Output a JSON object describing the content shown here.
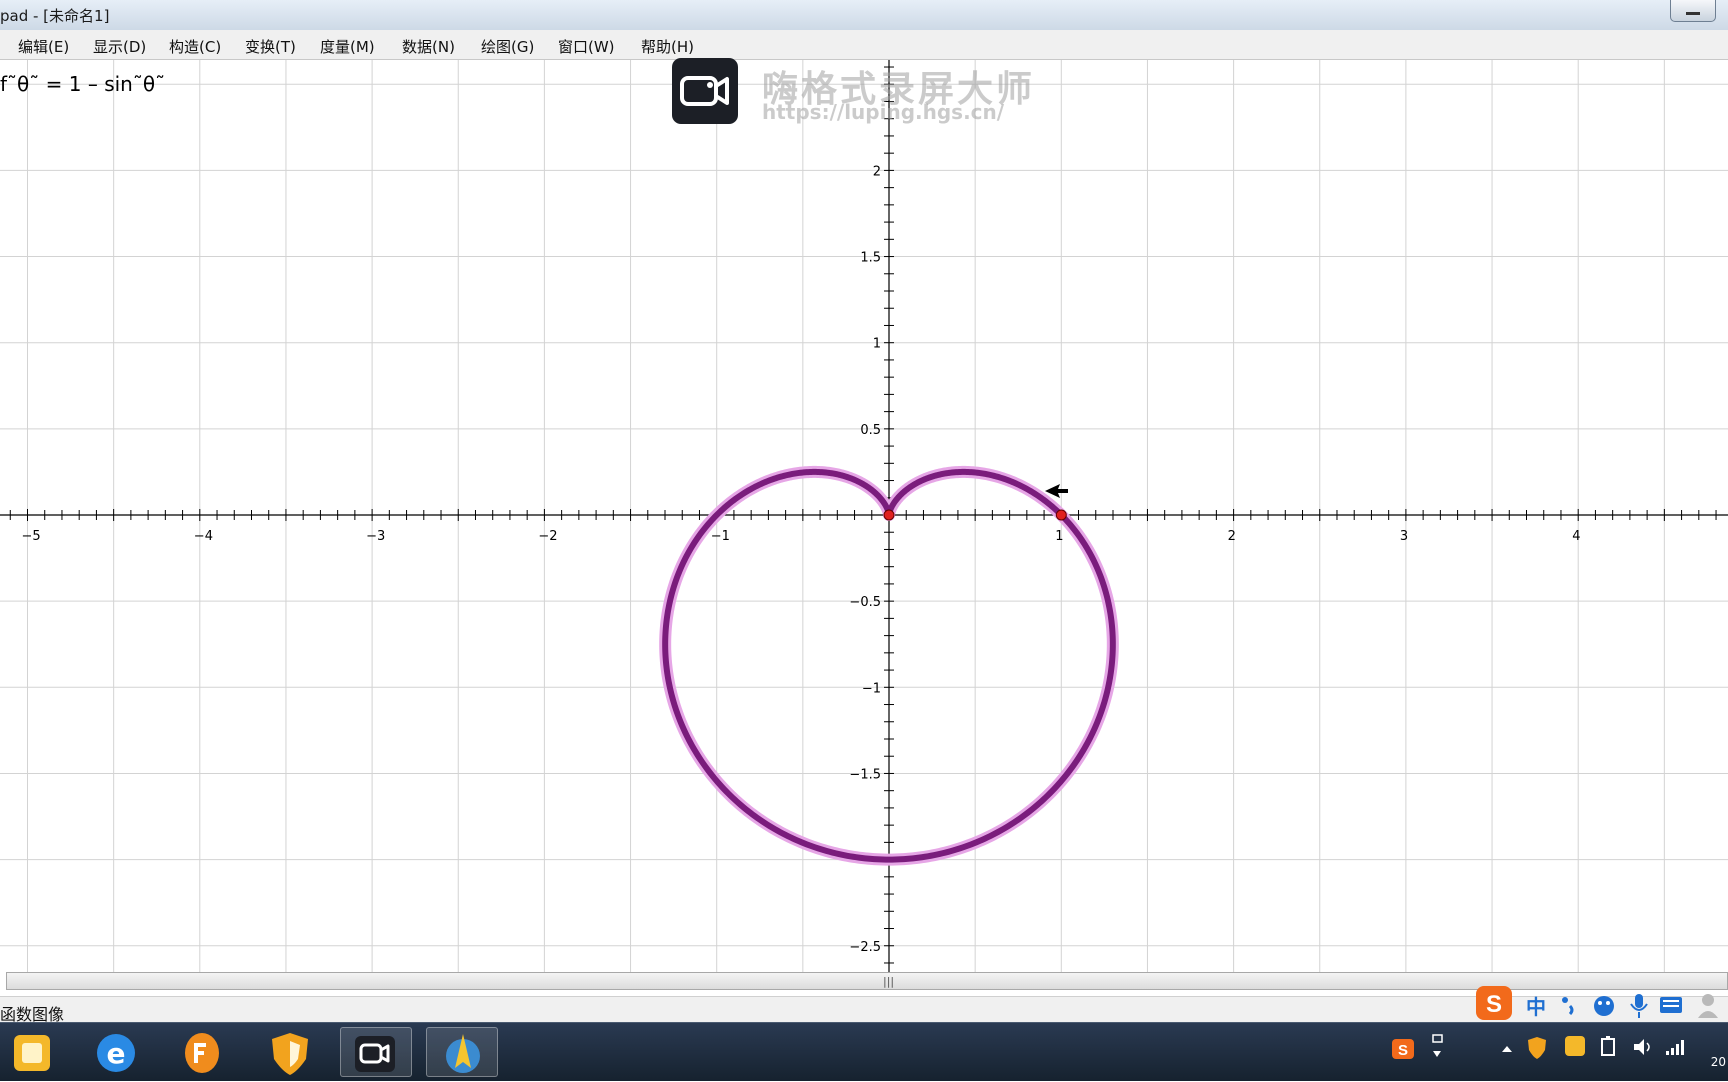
{
  "window": {
    "title": "pad  - [未命名1]"
  },
  "menu": [
    {
      "label": "编辑(E)"
    },
    {
      "label": "显示(D)"
    },
    {
      "label": "构造(C)"
    },
    {
      "label": "变换(T)"
    },
    {
      "label": "度量(M)"
    },
    {
      "label": "数据(N)"
    },
    {
      "label": "绘图(G)"
    },
    {
      "label": "窗口(W)"
    },
    {
      "label": "帮助(H)"
    }
  ],
  "formula": "f˜θ˜ = 1 – sin˜θ˜",
  "watermark": {
    "title": "嗨格式录屏大师",
    "url": "https://luping.hgs.cn/"
  },
  "graph": {
    "x_ticks": [
      "−5",
      "−4",
      "−3",
      "−2",
      "−1",
      "1",
      "2",
      "3",
      "4"
    ],
    "y_ticks": [
      "2",
      "1.5",
      "1",
      "0.5",
      "−0.5",
      "−1",
      "−1.5",
      "−2.5"
    ],
    "curve": {
      "equation": "r = 1 - sin(theta)",
      "color": "#7a1c7c",
      "glow_color": "#e6a6e6"
    },
    "points": [
      {
        "x": 0,
        "y": 0
      },
      {
        "x": 1,
        "y": 0
      }
    ],
    "point_color": "#e02020"
  },
  "status": "函数图像",
  "ime": {
    "label": "中"
  },
  "taskbar": {
    "clock": "20"
  }
}
